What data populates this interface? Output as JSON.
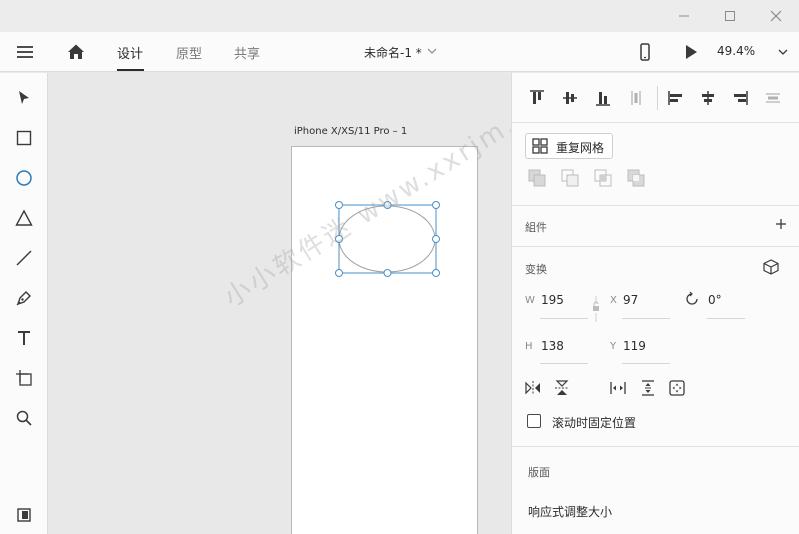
{
  "menubar": {
    "tabs": [
      {
        "label": "设计",
        "active": true
      },
      {
        "label": "原型",
        "active": false
      },
      {
        "label": "共享",
        "active": false
      }
    ],
    "doc_title": "未命名-1 *",
    "zoom": "49.4%"
  },
  "canvas": {
    "artboard_label": "iPhone X/XS/11 Pro – 1",
    "watermark": "小小软件迷  www.xxrjm.com"
  },
  "panel": {
    "repeat_grid_label": "重复网格",
    "components_title": "組件",
    "transform_title": "变换",
    "w_key": "W",
    "w_val": "195",
    "x_key": "X",
    "x_val": "97",
    "rotation_val": "0°",
    "h_key": "H",
    "h_val": "138",
    "y_key": "Y",
    "y_val": "119",
    "fixed_scroll_label": "滚动时固定位置",
    "layout_title": "版面",
    "responsive_label": "响应式调整大小"
  },
  "colors": {
    "accent": "#2d7ab5",
    "selection": "#4a90c8"
  }
}
